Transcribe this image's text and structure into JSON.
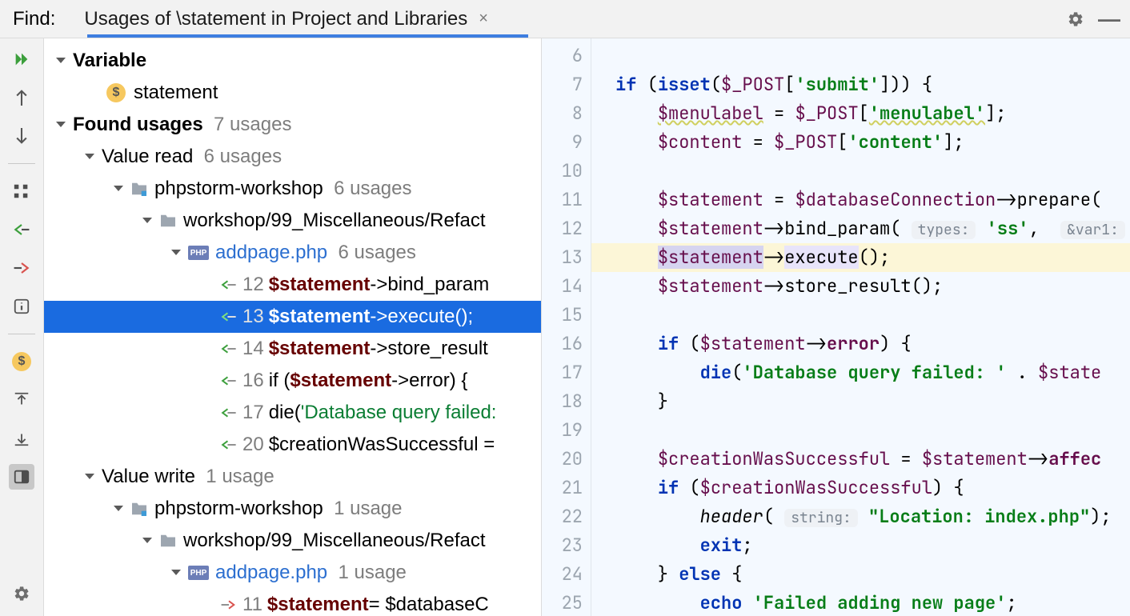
{
  "header": {
    "find_label": "Find:",
    "tab_title": "Usages of \\statement in Project and Libraries"
  },
  "tree": {
    "variable_heading": "Variable",
    "variable_name": "statement",
    "found_usages_heading": "Found usages",
    "found_usages_count": "7 usages",
    "value_read_heading": "Value read",
    "value_read_count": "6 usages",
    "project_name": "phpstorm-workshop",
    "project_read_count": "6 usages",
    "folder_path": "workshop/99_Miscellaneous/Refact",
    "file_name": "addpage.php",
    "file_read_count": "6 usages",
    "read_usages": [
      {
        "line": "12",
        "var": "$statement",
        "rest": "->bind_param"
      },
      {
        "line": "13",
        "var": "$statement",
        "rest": "->execute();"
      },
      {
        "line": "14",
        "var": "$statement",
        "rest": "->store_result"
      },
      {
        "line": "16",
        "prefix": "if (",
        "var": "$statement",
        "rest": "->error) {"
      },
      {
        "line": "17",
        "prefix": "die(",
        "str": "'Database query failed:"
      },
      {
        "line": "20",
        "plain": "$creationWasSuccessful ="
      }
    ],
    "value_write_heading": "Value write",
    "value_write_count": "1 usage",
    "project_write_count": "1 usage",
    "file_write_count": "1 usage",
    "write_usage": {
      "line": "11",
      "var": "$statement",
      "rest": " = $databaseC"
    }
  },
  "editor": {
    "gutter_start": 6,
    "gutter_end": 25,
    "lines": {
      "l6": "",
      "l7_kw1": "if",
      "l7_fn": "isset",
      "l7_var": "$_POST",
      "l7_key": "'submit'",
      "l8_var": "$menulabel",
      "l8_rhs": "$_POST",
      "l8_key": "'menulabel'",
      "l9_var": "$content",
      "l9_rhs": "$_POST",
      "l9_key": "'content'",
      "l11_var": "$statement",
      "l11_rhs": "$databaseConnection",
      "l11_m": "prepare",
      "l12_var": "$statement",
      "l12_m": "bind_param",
      "l12_h1": "types:",
      "l12_s": "'ss'",
      "l12_h2": "&var1:",
      "l13_var": "$statement",
      "l13_m": "execute",
      "l14_var": "$statement",
      "l14_m": "store_result",
      "l16_kw": "if",
      "l16_var": "$statement",
      "l16_m": "error",
      "l17_fn": "die",
      "l17_s": "'Database query failed: '",
      "l17_var": "$state",
      "l20_var": "$creationWasSuccessful",
      "l20_rhs": "$statement",
      "l20_m": "affec",
      "l21_kw": "if",
      "l21_var": "$creationWasSuccessful",
      "l22_fn": "header",
      "l22_h": "string:",
      "l22_s": "\"Location: index.php\"",
      "l23_kw": "exit",
      "l24_kw": "else",
      "l25_kw": "echo",
      "l25_s": "'Failed adding new page'"
    }
  }
}
